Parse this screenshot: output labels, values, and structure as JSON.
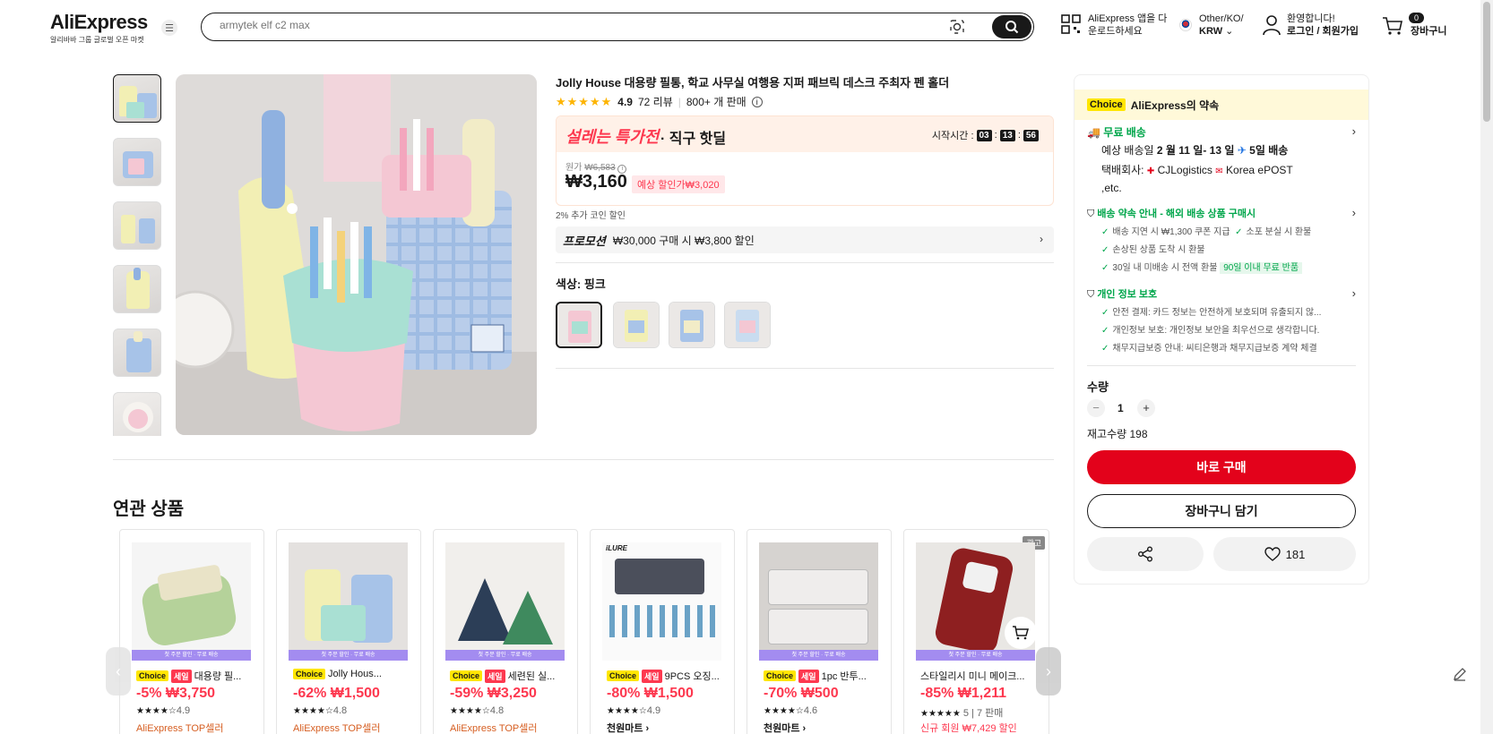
{
  "header": {
    "logo": "AliExpress",
    "logo_sub": "알리바바 그룹 글로벌 오픈 마켓",
    "search_placeholder": "armytek elf c2 max",
    "app_download_line1": "AliExpress 앱을 다",
    "app_download_line2": "운로드하세요",
    "region_line1": "Other/KO/",
    "region_line2": "KRW",
    "account_line1": "환영합니다!",
    "account_line2": "로그인 / 회원가입",
    "cart_count": "0",
    "cart_label": "장바구니"
  },
  "product": {
    "title": "Jolly House 대용량 필통, 학교 사무실 여행용 지퍼 패브릭 데스크 주최자 펜 홀더",
    "rating": "4.9",
    "reviews": "72 리뷰",
    "sold": "800+ 개 판매",
    "deal_brand": "설레는 특가전",
    "deal_sub": "· 직구 핫딜",
    "timer_label": "시작시간 :",
    "timer_h": "03",
    "timer_m": "13",
    "timer_s": "56",
    "orig_label": "원가",
    "orig_price": "₩6,583",
    "price": "₩3,160",
    "est_price": "예상 할인가₩3,020",
    "coin_discount": "2% 추가 코인 할인",
    "promo_label": "프로모션",
    "promo_text": "₩30,000 구매 시 ₩3,800 할인",
    "color_label": "색상: 핑크"
  },
  "related": {
    "title": "연관 상품",
    "strip_text": "첫 주문 할인 · 무료 배송",
    "items": [
      {
        "name": "대용량 필...",
        "choice": "Choice",
        "sale": "세일",
        "price": "-5% ₩3,750",
        "stars": "★★★★☆",
        "rating": "4.9",
        "store": "AliExpress TOP셀러"
      },
      {
        "name": "Jolly Hous...",
        "choice": "Choice",
        "sale": "",
        "price": "-62% ₩1,500",
        "stars": "★★★★☆",
        "rating": "4.8",
        "store": "AliExpress TOP셀러"
      },
      {
        "name": "세련된 실...",
        "choice": "Choice",
        "sale": "세일",
        "price": "-59% ₩3,250",
        "stars": "★★★★☆",
        "rating": "4.8",
        "store": "AliExpress TOP셀러"
      },
      {
        "name": "9PCS 오징...",
        "choice": "Choice",
        "sale": "세일",
        "price": "-80% ₩1,500",
        "stars": "★★★★☆",
        "rating": "4.9",
        "store": "천원마트 ›"
      },
      {
        "name": "1pc 반투...",
        "choice": "Choice",
        "sale": "세일",
        "price": "-70% ₩500",
        "stars": "★★★★☆",
        "rating": "4.6",
        "store": "천원마트 ›"
      },
      {
        "name": "스타일리시 미니 메이크...",
        "choice": "",
        "sale": "",
        "price": "-85% ₩1,211",
        "stars": "★★★★★",
        "rating": "5 | 7 판매",
        "store": "신규 회원 ₩7,429 할인",
        "ad": "광고"
      }
    ]
  },
  "panel": {
    "choice_tag": "Choice",
    "promise_title": "AliExpress의 약속",
    "free_shipping": "무료 배송",
    "delivery_prefix": "예상 배송일",
    "delivery_range": "2 월 11 일- 13 일",
    "delivery_days": "5일 배송",
    "carrier_label": "택배회사:",
    "carrier1": "CJLogistics",
    "carrier2": "Korea",
    "carrier3": "ePOST ,etc.",
    "guarantee_title": "배송 약속 안내 - 해외 배송 상품 구매시",
    "g1": "배송 지연 시 ₩1,300 쿠폰 지급",
    "g2": "소포 분실 시 환불",
    "g3": "손상된 상품 도착 시 환불",
    "g4": "30일 내 미배송 시 전액 환불",
    "g4_tag": "90일 이내 무료 반품",
    "privacy_title": "개인 정보 보호",
    "p1": "안전 결제: 카드 정보는 안전하게 보호되며 유출되지 않...",
    "p2": "개인정보 보호: 개인정보 보안을 최우선으로 생각합니다.",
    "p3": "채무지급보증 안내: 씨티은행과 채무지급보증 계약 체결",
    "qty_label": "수량",
    "qty": "1",
    "stock": "재고수량 198",
    "buy_now": "바로 구매",
    "add_cart": "장바구니 담기",
    "wish_count": "181"
  }
}
